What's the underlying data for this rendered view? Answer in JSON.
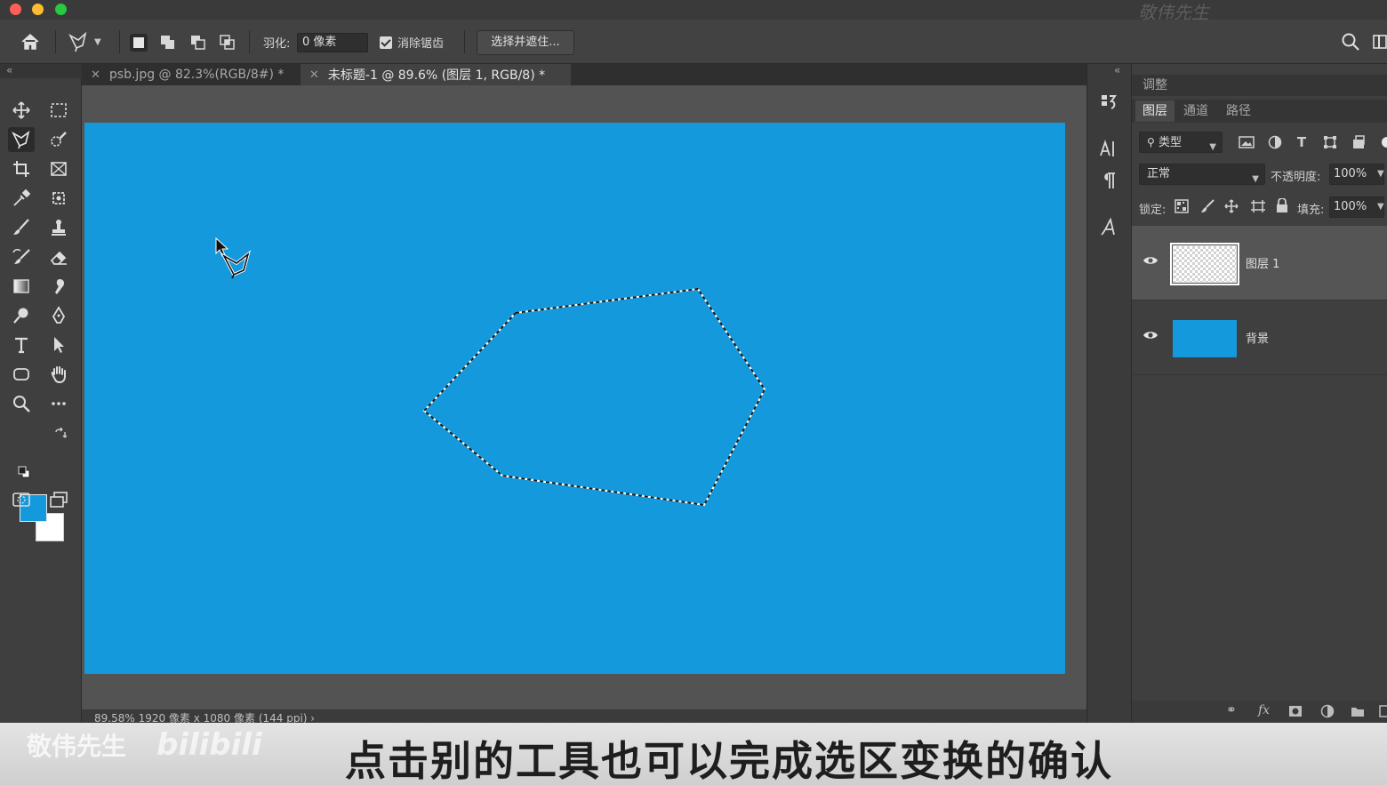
{
  "window": {
    "watermark_top": "敬伟先生"
  },
  "options_bar": {
    "feather_label": "羽化:",
    "feather_value": "0 像素",
    "antialias_label": "消除锯齿",
    "antialias_checked": true,
    "select_mask_label": "选择并遮住..."
  },
  "tabs": [
    {
      "label": "psb.jpg @ 82.3%(RGB/8#) *",
      "active": false
    },
    {
      "label": "未标题-1 @ 89.6% (图层 1, RGB/8) *",
      "active": true
    }
  ],
  "colors": {
    "foreground": "#1499dd",
    "background": "#ffffff",
    "document_fill": "#1499dd"
  },
  "tools": [
    "move-tool",
    "marquee-tool",
    "polygonal-lasso-tool",
    "quick-selection-tool",
    "crop-tool",
    "frame-tool",
    "eyedropper-tool",
    "patch-tool",
    "brush-tool",
    "clone-stamp-tool",
    "history-brush-tool",
    "eraser-tool",
    "gradient-tool",
    "smudge-tool",
    "dodge-tool",
    "pen-tool",
    "type-tool",
    "path-selection-tool",
    "rectangle-tool",
    "hand-tool",
    "zoom-tool",
    "more-tools"
  ],
  "active_tool": "polygonal-lasso-tool",
  "status": {
    "text": "89.58%    1920 像素 x 1080 像素 (144 ppi)   ›"
  },
  "panels": {
    "adjustments_tab": "调整",
    "tabs": [
      "图层",
      "通道",
      "路径"
    ],
    "active_tab": "图层",
    "filter_label": "类型",
    "blend_mode": "正常",
    "opacity_label": "不透明度:",
    "opacity_value": "100%",
    "lock_label": "锁定:",
    "fill_label": "填充:",
    "fill_value": "100%",
    "layers": [
      {
        "name": "图层 1",
        "visible": true,
        "selected": true,
        "thumb": "transparent"
      },
      {
        "name": "背景",
        "visible": true,
        "selected": false,
        "thumb": "blue"
      }
    ]
  },
  "subtitle": {
    "text": "点击别的工具也可以完成选区变换的确认",
    "watermark_name": "敬伟先生",
    "watermark_logo": "bilibili"
  }
}
